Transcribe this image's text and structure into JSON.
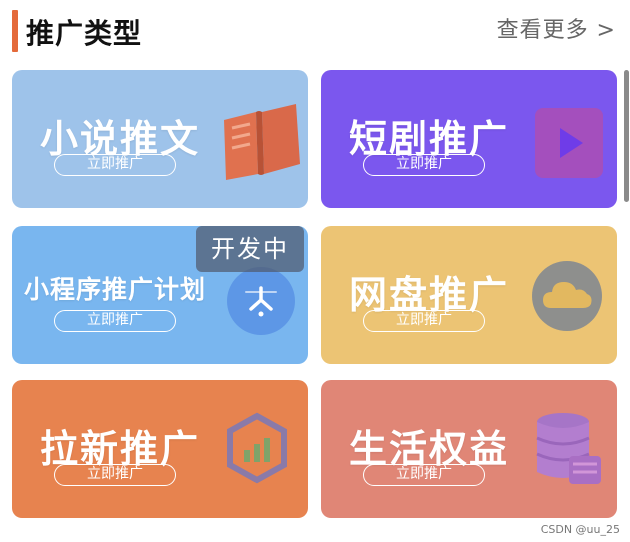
{
  "header": {
    "title": "推广类型",
    "more": "查看更多 >"
  },
  "cards": {
    "novel": {
      "title": "小说推文",
      "button": "立即推广",
      "icon": "open-book-icon",
      "color": "#9ec3ea"
    },
    "drama": {
      "title": "短剧推广",
      "button": "立即推广",
      "icon": "play-icon",
      "color": "#7b57ee"
    },
    "mini": {
      "title": "小程序推广计划",
      "button": "立即推广",
      "icon": "mini-program-icon",
      "color": "#79b6ef",
      "status": "开发中"
    },
    "disk": {
      "title": "网盘推广",
      "button": "立即推广",
      "icon": "cloud-icon",
      "color": "#ecc474"
    },
    "new": {
      "title": "拉新推广",
      "button": "立即推广",
      "icon": "chart-hexagon-icon",
      "color": "#e7834f"
    },
    "life": {
      "title": "生活权益",
      "button": "立即推广",
      "icon": "database-icon",
      "color": "#e08676"
    }
  },
  "watermark": "CSDN @uu_25"
}
